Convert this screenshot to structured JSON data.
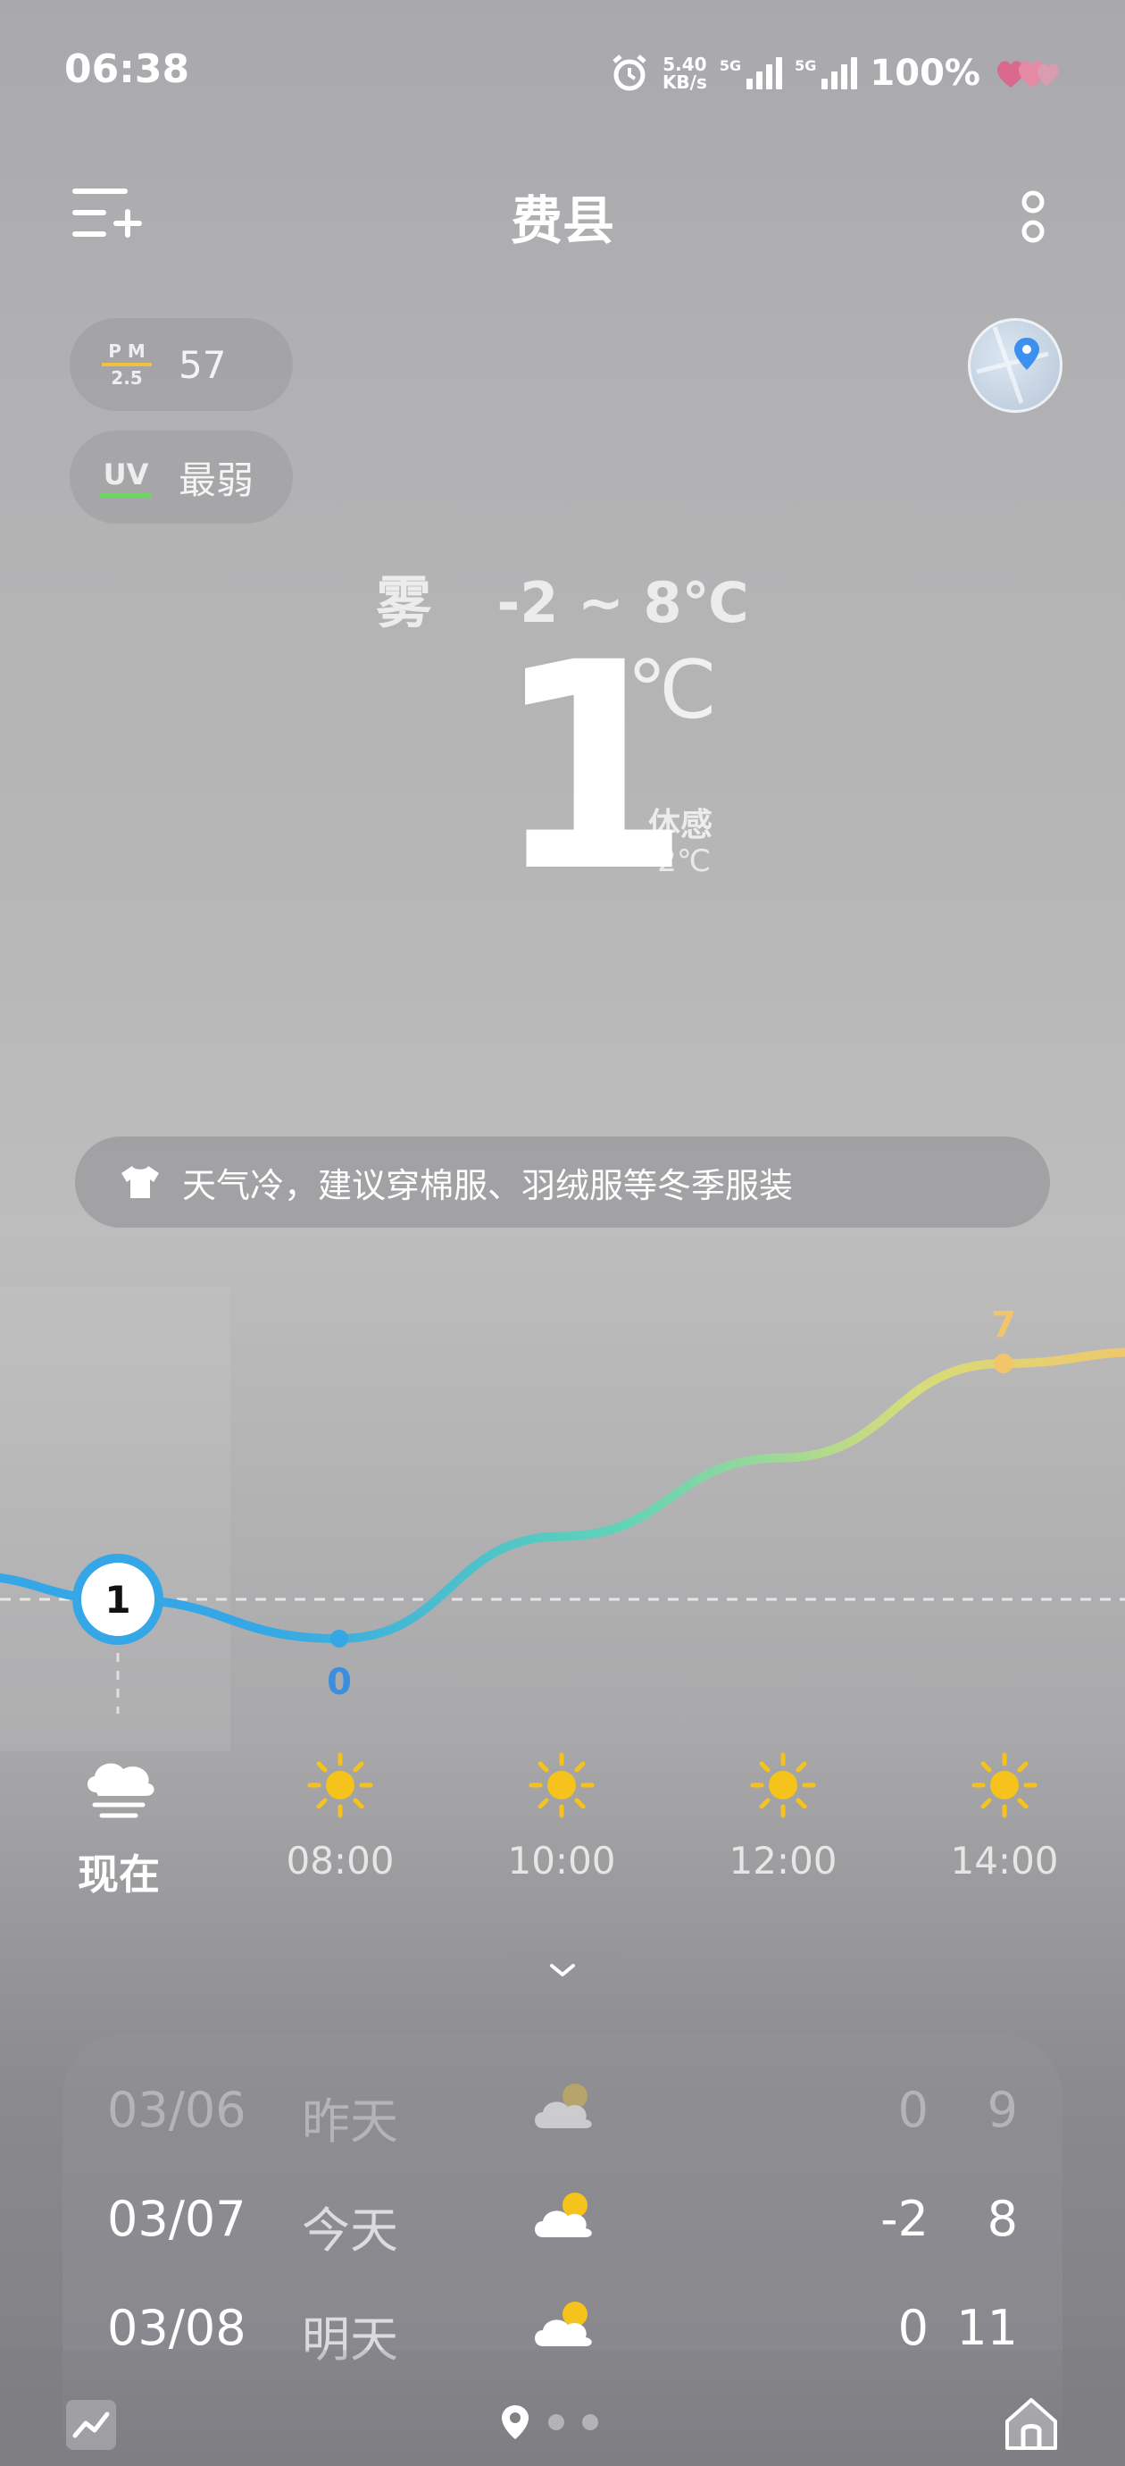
{
  "status_bar": {
    "time": "06:38",
    "net_speed_value": "5.40",
    "net_speed_unit": "KB/s",
    "sim1_label": "5G",
    "sim2_label": "5G",
    "battery": "100%"
  },
  "header": {
    "city": "费县"
  },
  "air": {
    "pm_label_top": "P M",
    "pm_label_bottom": "2.5",
    "pm_value": "57",
    "uv_label": "UV",
    "uv_value": "最弱"
  },
  "current": {
    "condition": "雾",
    "range": "-2 ~ 8℃",
    "temp": "1",
    "unit": "℃",
    "feels_label": "体感",
    "feels_value": "-2℃"
  },
  "tip": {
    "text": "天气冷，建议穿棉服、羽绒服等冬季服装"
  },
  "chart_data": {
    "type": "line",
    "series": [
      {
        "values": [
          1,
          0,
          2.6,
          4.6,
          7,
          7.3
        ]
      }
    ],
    "x": [
      "现在",
      "08:00",
      "10:00",
      "12:00",
      "14:00",
      ""
    ],
    "data_labels": {
      "now": "1",
      "min": "0",
      "max": "7"
    },
    "colors": [
      "#35a7e6",
      "#5fd3b7",
      "#f2c56b"
    ]
  },
  "hourly": [
    {
      "label": "现在",
      "icon": "fog-cloud-icon"
    },
    {
      "label": "08:00",
      "icon": "sun-icon"
    },
    {
      "label": "10:00",
      "icon": "sun-icon"
    },
    {
      "label": "12:00",
      "icon": "sun-icon"
    },
    {
      "label": "14:00",
      "icon": "sun-icon"
    }
  ],
  "daily": [
    {
      "date": "03/06",
      "name": "昨天",
      "low": "0",
      "high": "9",
      "icon": "partly-cloudy-icon"
    },
    {
      "date": "03/07",
      "name": "今天",
      "low": "-2",
      "high": "8",
      "icon": "partly-cloudy-icon"
    },
    {
      "date": "03/08",
      "name": "明天",
      "low": "0",
      "high": "11",
      "icon": "partly-cloudy-icon"
    }
  ],
  "colors": {
    "sun": "#f6c21c",
    "pm_bar": "#f0c23b",
    "uv_bar": "#6fd36a"
  }
}
